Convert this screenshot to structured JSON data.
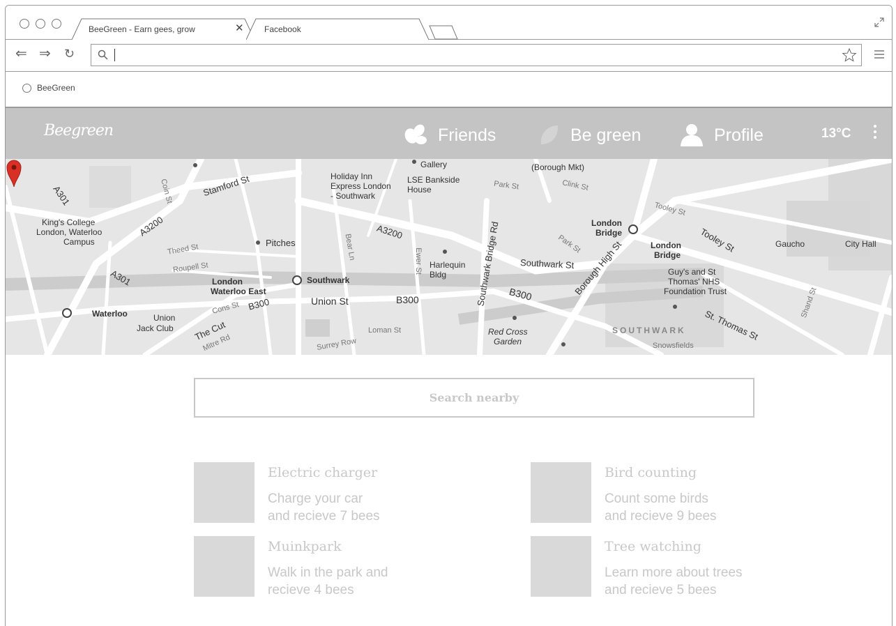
{
  "browser": {
    "tabs": [
      {
        "title": "BeeGreen - Earn gees, grow",
        "close": "✕"
      },
      {
        "title": "Facebook"
      }
    ],
    "bookmarks": [
      {
        "label": "BeeGreen"
      }
    ]
  },
  "app": {
    "logo": "Beegreen",
    "nav": [
      {
        "label": "Friends",
        "icon": "bee-icon"
      },
      {
        "label": "Be green",
        "icon": "leaf-icon"
      },
      {
        "label": "Profile",
        "icon": "person-icon"
      }
    ],
    "temperature": "13°C"
  },
  "map": {
    "labels": [
      {
        "text": "Gallery"
      },
      {
        "text": "(Borough Mkt)"
      },
      {
        "text": "Holiday Inn"
      },
      {
        "text": "Express London"
      },
      {
        "text": "- Southwark"
      },
      {
        "text": "LSE Bankside"
      },
      {
        "text": "House"
      },
      {
        "text": "Park St"
      },
      {
        "text": "Clink St"
      },
      {
        "text": "Stamford St"
      },
      {
        "text": "Coin St"
      },
      {
        "text": "A301"
      },
      {
        "text": "King's College"
      },
      {
        "text": "London, Waterloo"
      },
      {
        "text": "Campus"
      },
      {
        "text": "A3200"
      },
      {
        "text": "Theed St"
      },
      {
        "text": "Pitches"
      },
      {
        "text": "Bear Ln"
      },
      {
        "text": "A3200"
      },
      {
        "text": "Ewer St"
      },
      {
        "text": "Harlequin"
      },
      {
        "text": "Bldg"
      },
      {
        "text": "Southwark Bridge Rd"
      },
      {
        "text": "Southwark St"
      },
      {
        "text": "London"
      },
      {
        "text": "Bridge"
      },
      {
        "text": "London"
      },
      {
        "text": "Bridge"
      },
      {
        "text": "Tooley St"
      },
      {
        "text": "Tooley St"
      },
      {
        "text": "Gaucho"
      },
      {
        "text": "City Hall"
      },
      {
        "text": "Park St"
      },
      {
        "text": "Borough High St"
      },
      {
        "text": "Guy's and St"
      },
      {
        "text": "Thomas' NHS"
      },
      {
        "text": "Foundation Trust"
      },
      {
        "text": "Roupell St"
      },
      {
        "text": "London"
      },
      {
        "text": "Waterloo East"
      },
      {
        "text": "Southwark"
      },
      {
        "text": "A301"
      },
      {
        "text": "Union St"
      },
      {
        "text": "B300"
      },
      {
        "text": "B300"
      },
      {
        "text": "Waterloo"
      },
      {
        "text": "Union"
      },
      {
        "text": "Jack Club"
      },
      {
        "text": "Cons St"
      },
      {
        "text": "B300"
      },
      {
        "text": "The Cut"
      },
      {
        "text": "Mitre Rd"
      },
      {
        "text": "Loman St"
      },
      {
        "text": "Red Cross"
      },
      {
        "text": "Garden"
      },
      {
        "text": "SOUTHWARK"
      },
      {
        "text": "St. Thomas St"
      },
      {
        "text": "Snowsfields"
      },
      {
        "text": "Surrey Row"
      },
      {
        "text": "Shand St"
      }
    ]
  },
  "search": {
    "label": "Search nearby"
  },
  "activities": [
    {
      "title": "Electric charger",
      "desc": "Charge your car\nand recieve 7 bees"
    },
    {
      "title": "Bird counting",
      "desc": "Count some birds\nand recieve 9 bees"
    },
    {
      "title": "Muinkpark",
      "desc": "Walk in the park and\nrecieve 4 bees"
    },
    {
      "title": "Tree watching",
      "desc": "Learn more about trees\nand recieve 5 bees"
    }
  ]
}
